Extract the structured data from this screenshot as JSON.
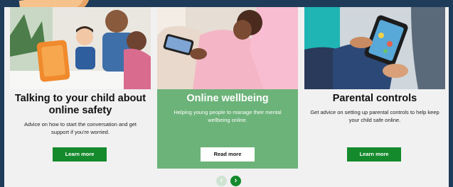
{
  "cards": [
    {
      "title": "Talking to your child about online safety",
      "description": "Advice on how to start the conversation and get support if you're worried.",
      "button_label": "Learn more",
      "image_alt": "Parent and children looking at an orange tablet"
    },
    {
      "title": "Online wellbeing",
      "description": "Helping young people to manage their mental wellbeing online.",
      "button_label": "Read more",
      "image_alt": "Child looking at a smartphone"
    },
    {
      "title": "Parental controls",
      "description": "Get advice on setting up parental controls to help keep your child safe online.",
      "button_label": "Learn more",
      "image_alt": "Child and adult using a tablet"
    }
  ],
  "carousel": {
    "prev_icon": "chevron-left-icon",
    "next_icon": "chevron-right-icon",
    "prev_glyph": "‹",
    "next_glyph": "›"
  },
  "colors": {
    "accent_green": "#148a2c",
    "card_green": "#6cb379",
    "frame_navy": "#1f3b5a",
    "panel_bg": "#f1f1f1"
  }
}
